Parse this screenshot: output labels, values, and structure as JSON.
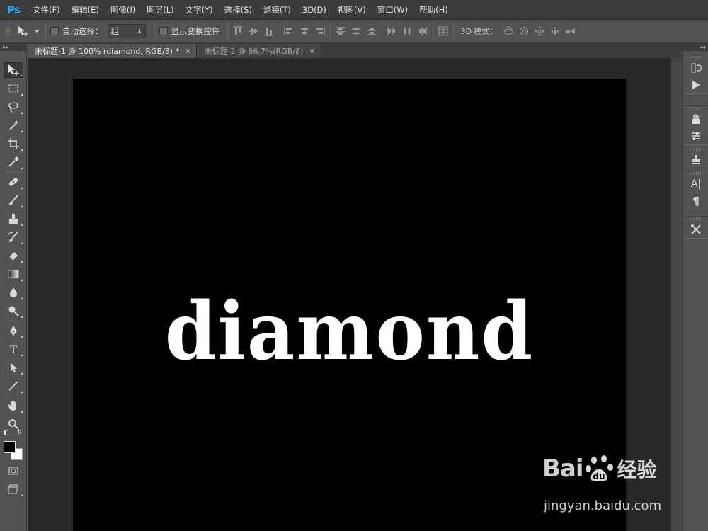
{
  "app": {
    "logo": "Ps",
    "menus": [
      "文件(F)",
      "编辑(E)",
      "图像(I)",
      "图层(L)",
      "文字(Y)",
      "选择(S)",
      "滤镜(T)",
      "3D(D)",
      "视图(V)",
      "窗口(W)",
      "帮助(H)"
    ]
  },
  "options": {
    "auto_select_label": "自动选择：",
    "auto_select_checked": false,
    "auto_select_value": "组",
    "show_transform_label": "显示变换控件",
    "show_transform_checked": false,
    "mode_3d_label": "3D 模式："
  },
  "tabs": [
    {
      "title": "未标题-1 @ 100% (diamond, RGB/8) *",
      "active": true,
      "close": "×"
    },
    {
      "title": "未标题-2 @ 66.7%(RGB/8)",
      "active": false,
      "close": "×"
    }
  ],
  "canvas": {
    "text": "diamond",
    "background": "#000000",
    "text_color": "#ffffff"
  },
  "toolbar": {
    "collapse_glyph": "▸▸",
    "tools": [
      "move",
      "marquee",
      "lasso",
      "magic-wand",
      "crop",
      "eyedropper",
      "healing",
      "brush",
      "stamp",
      "history-brush",
      "eraser",
      "gradient",
      "blur",
      "dodge",
      "pen",
      "type",
      "path-select",
      "line",
      "hand",
      "zoom"
    ],
    "type_tool_glyph": "T",
    "foreground_color": "#000000",
    "background_color": "#ffffff"
  },
  "right_dock": {
    "collapse_glyph": "◂◂",
    "char_panel_glyph": "A|",
    "paragraph_glyph": "¶"
  },
  "watermark": {
    "brand_left": "Bai",
    "brand_right": "经验",
    "url": "jingyan.baidu.com"
  }
}
